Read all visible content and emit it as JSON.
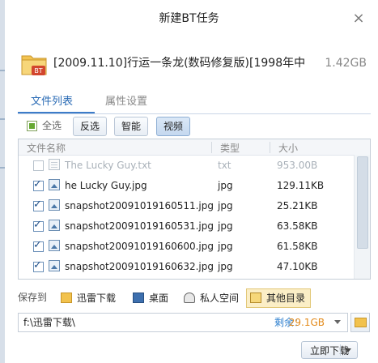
{
  "dialog": {
    "title": "新建BT任务",
    "close_glyph": "×"
  },
  "task": {
    "name": "[2009.11.10]行运一条龙(数码修复版)[1998年中...",
    "size": "1.42GB",
    "icon_badge": "BT"
  },
  "tabs": [
    {
      "label": "文件列表"
    },
    {
      "label": "属性设置"
    }
  ],
  "toolbar": {
    "select_all": "全选",
    "invert": "反选",
    "smart": "智能",
    "video": "视频"
  },
  "columns": {
    "name": "文件名称",
    "type": "类型",
    "size": "大小"
  },
  "files": [
    {
      "name": "The Lucky Guy.txt",
      "type": "txt",
      "size": "953.00B",
      "checked": false
    },
    {
      "name": "he Lucky Guy.jpg",
      "type": "jpg",
      "size": "129.11KB",
      "checked": true
    },
    {
      "name": "snapshot20091019160511.jpg",
      "type": "jpg",
      "size": "25.21KB",
      "checked": true
    },
    {
      "name": "snapshot20091019160531.jpg",
      "type": "jpg",
      "size": "63.58KB",
      "checked": true
    },
    {
      "name": "snapshot20091019160600.jpg",
      "type": "jpg",
      "size": "61.58KB",
      "checked": true
    },
    {
      "name": "snapshot20091019160632.jpg",
      "type": "jpg",
      "size": "47.10KB",
      "checked": true
    }
  ],
  "save": {
    "label": "保存到",
    "destinations": [
      {
        "label": "迅雷下载",
        "icon": "folder-icon"
      },
      {
        "label": "桌面",
        "icon": "desktop-icon"
      },
      {
        "label": "私人空间",
        "icon": "private-space-icon"
      },
      {
        "label": "其他目录",
        "icon": "other-folder-icon",
        "selected": true
      }
    ],
    "path": "f:\\迅雷下载\\",
    "free_label": "剩余：",
    "free_value": "29.1GB"
  },
  "actions": {
    "download_now": "立即下载"
  }
}
